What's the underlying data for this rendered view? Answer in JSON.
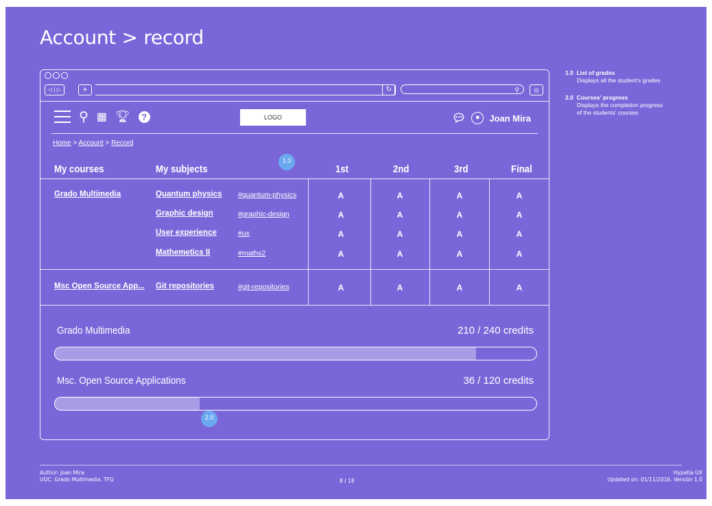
{
  "page_title": "Account > record",
  "browser": {
    "nav_back": "◁",
    "nav_forward": "▷",
    "new_tab": "+",
    "reload": "↻",
    "search_icon": "🔍",
    "settings_icon": "◎"
  },
  "toolbar": {
    "logo": "LOGO",
    "user_name": "Joan Mira"
  },
  "breadcrumb": {
    "home": "Home",
    "sep1": ">",
    "account": "Account",
    "sep2": ">",
    "record": "Record"
  },
  "table": {
    "headers": {
      "courses": "My courses",
      "subjects": "My subjects",
      "first": "1st",
      "second": "2nd",
      "third": "3rd",
      "final": "Final"
    },
    "groups": [
      {
        "course": "Grado Multimedia",
        "rows": [
          {
            "subject": "Quantum physics",
            "tag": "#quantum-physics",
            "grades": [
              "A",
              "A",
              "A",
              "A"
            ]
          },
          {
            "subject": "Graphic design",
            "tag": "#graphic-design",
            "grades": [
              "A",
              "A",
              "A",
              "A"
            ]
          },
          {
            "subject": "User experience",
            "tag": "#ux",
            "grades": [
              "A",
              "A",
              "A",
              "A"
            ]
          },
          {
            "subject": "Mathemetics II",
            "tag": "#maths2",
            "grades": [
              "A",
              "A",
              "A",
              "A"
            ]
          }
        ]
      },
      {
        "course": "Msc Open Source App...",
        "rows": [
          {
            "subject": "Git repositories",
            "tag": "#git-repositories",
            "grades": [
              "A",
              "A",
              "A",
              "A"
            ]
          }
        ]
      }
    ]
  },
  "progress": [
    {
      "title": "Grado Multimedia",
      "value_text": "210 / 240 credits",
      "fraction": 0.875
    },
    {
      "title": "Msc. Open Source Applications",
      "value_text": "36 / 120 credits",
      "fraction": 0.3
    }
  ],
  "markers": {
    "m1": "1.0",
    "m2": "2.0"
  },
  "notes": [
    {
      "num": "1.0",
      "title": "List of grades",
      "desc": "Displays all the student's grades"
    },
    {
      "num": "2.0",
      "title": "Courses' progress",
      "desc1": "Displays the completion progress",
      "desc2": "of the students' courses"
    }
  ],
  "footer": {
    "author": "Author: Joan Mira",
    "org": "UOC. Grado Multimedia. TFG",
    "page": "8 / 18",
    "brand": "Hypatia UX",
    "updated": "Updated on: 01/11/2016. Versión 1.0"
  }
}
